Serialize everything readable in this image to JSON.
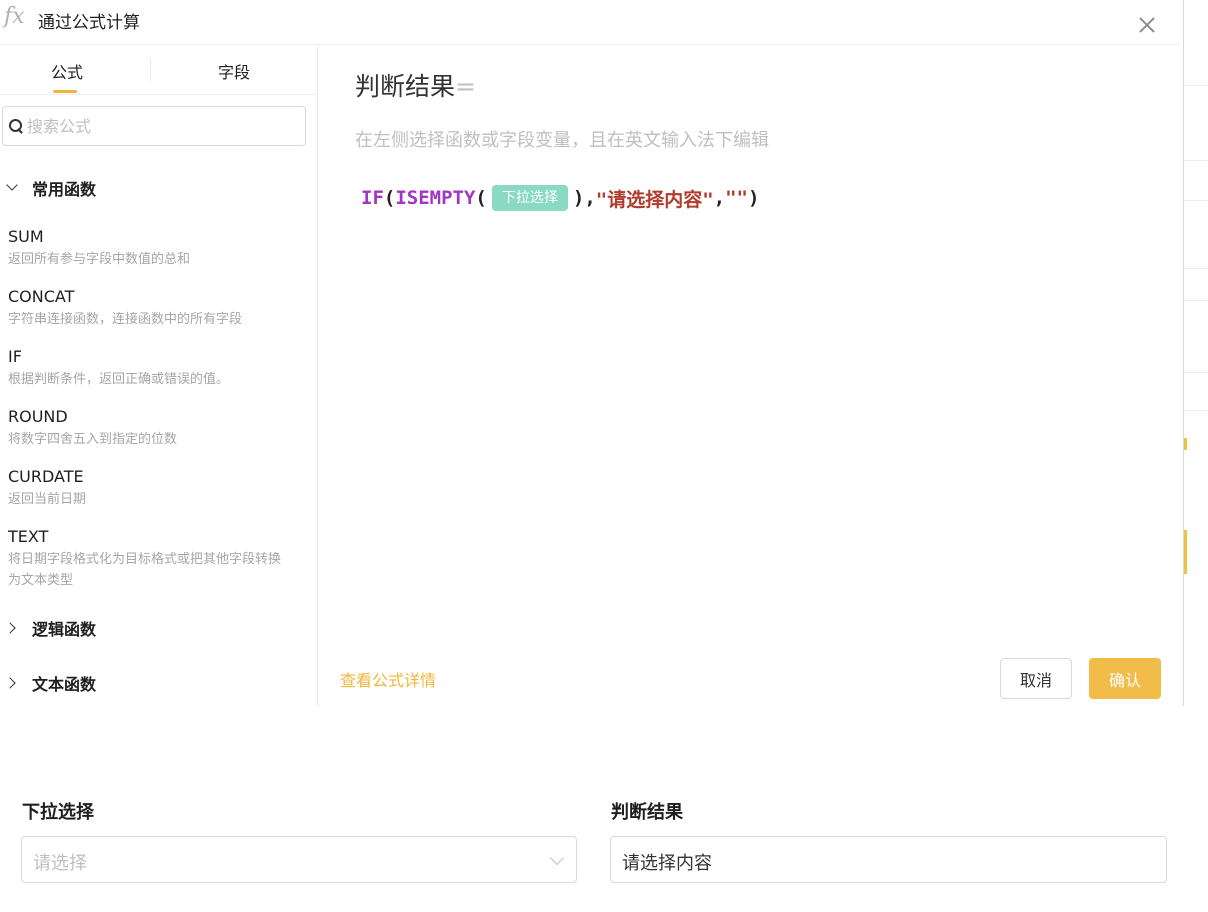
{
  "dialog": {
    "title": "通过公式计算",
    "tabs": [
      "公式",
      "字段"
    ],
    "search": {
      "placeholder": "搜索公式"
    },
    "groups": {
      "common": {
        "label": "常用函数",
        "functions": [
          {
            "name": "SUM",
            "desc": "返回所有参与字段中数值的总和"
          },
          {
            "name": "CONCAT",
            "desc": "字符串连接函数，连接函数中的所有字段"
          },
          {
            "name": "IF",
            "desc": "根据判断条件，返回正确或错误的值。"
          },
          {
            "name": "ROUND",
            "desc": "将数字四舍五入到指定的位数"
          },
          {
            "name": "CURDATE",
            "desc": "返回当前日期"
          },
          {
            "name": "TEXT",
            "desc": "将日期字段格式化为目标格式或把其他字段转换为文本类型"
          }
        ]
      },
      "logic": {
        "label": "逻辑函数"
      },
      "text": {
        "label": "文本函数"
      }
    },
    "editor": {
      "target_field": "判断结果",
      "equals": "=",
      "hint": "在左侧选择函数或字段变量，且在英文输入法下编辑",
      "formula": {
        "fn_if": "IF",
        "open1": "(",
        "fn_isempty": "ISEMPTY",
        "open2": "(",
        "field_chip": "下拉选择",
        "close_comma": "),",
        "str_true": "\"请选择内容\"",
        "comma": ",",
        "str_false": "\"\"",
        "close": ")"
      }
    },
    "footer": {
      "view_details": "查看公式详情",
      "cancel": "取消",
      "confirm": "确认"
    }
  },
  "form": {
    "dropdown": {
      "label": "下拉选择",
      "placeholder": "请选择"
    },
    "result": {
      "label": "判断结果",
      "value": "请选择内容"
    }
  },
  "colors": {
    "accent": "#f2bc48",
    "function": "#a335c4",
    "string": "#b23b2d",
    "field_chip": "#8ad9c2"
  }
}
